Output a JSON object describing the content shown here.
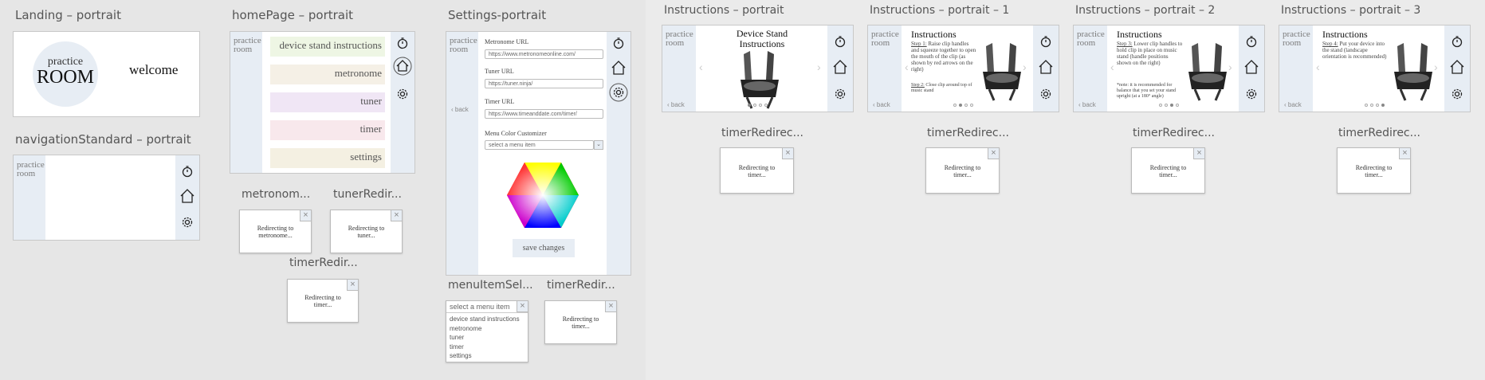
{
  "colors": {
    "nav_bg": "#e7edf4",
    "item_green": "#eef6e4",
    "item_beige": "#f5f0e6",
    "item_purple": "#f0e6f5",
    "item_pink": "#f8e8ec",
    "item_cream": "#f4f0e2",
    "save_bg": "#e7edf4"
  },
  "brand": {
    "practice": "practice",
    "room": "room"
  },
  "landing": {
    "label": "Landing – portrait",
    "logo_top": "practice",
    "logo_bottom": "ROOM",
    "welcome": "welcome"
  },
  "nav": {
    "label": "navigationStandard – portrait",
    "icons": [
      "stopwatch-icon",
      "home-icon",
      "gear-icon"
    ]
  },
  "home": {
    "label": "homePage – portrait",
    "items": [
      "device stand instructions",
      "metronome",
      "tuner",
      "timer",
      "settings"
    ]
  },
  "settings": {
    "label": "Settings-portrait",
    "back": "back",
    "metronome_label": "Metronome URL",
    "metronome_value": "https://www.metronomeonline.com/",
    "tuner_label": "Tuner URL",
    "tuner_value": "https://tuner.ninja/",
    "timer_label": "Timer URL",
    "timer_value": "https://www.timeanddate.com/timer/",
    "color_label": "Menu Color Customizer",
    "color_placeholder": "select a menu item",
    "save": "save changes"
  },
  "popups": {
    "metronome": {
      "label": "metronom...",
      "title_1": "Redirecting to",
      "title_2": "metronome..."
    },
    "tuner": {
      "label": "tunerRedir...",
      "title_1": "Redirecting to",
      "title_2": "tuner..."
    },
    "timer": {
      "label": "timerRedir...",
      "title_1": "Redirecting to",
      "title_2": "timer..."
    },
    "timer2": {
      "label": "timerRedir...",
      "title_1": "Redirecting to",
      "title_2": "timer..."
    },
    "timer_i0": {
      "label": "timerRedirec...",
      "title_1": "Redirecting to",
      "title_2": "timer..."
    },
    "timer_i1": {
      "label": "timerRedirec...",
      "title_1": "Redirecting to",
      "title_2": "timer..."
    },
    "timer_i2": {
      "label": "timerRedirec...",
      "title_1": "Redirecting to",
      "title_2": "timer..."
    },
    "timer_i3": {
      "label": "timerRedirec...",
      "title_1": "Redirecting to",
      "title_2": "timer..."
    }
  },
  "menu_select": {
    "label": "menuItemSel...",
    "placeholder": "select a menu item",
    "options": [
      "device stand instructions",
      "metronome",
      "tuner",
      "timer",
      "settings"
    ]
  },
  "instructions": [
    {
      "label": "Instructions – portrait",
      "title_1": "Device Stand",
      "title_2": "Instructions",
      "back": "back",
      "step_label": "",
      "text": "",
      "step2_label": "",
      "text2": "",
      "active_dot": 1
    },
    {
      "label": "Instructions – portrait – 1",
      "title_1": "Instructions",
      "title_2": "",
      "back": "back",
      "step_label": "Step 1:",
      "text": "Raise clip handles and squeeze together to open the mouth of the clip (as shown by red arrows on the right)",
      "step2_label": "Step 2:",
      "text2": "Close clip around top of music stand",
      "active_dot": 2
    },
    {
      "label": "Instructions – portrait – 2",
      "title_1": "Instructions",
      "title_2": "",
      "back": "back",
      "step_label": "Step 3:",
      "text": "Lower clip handles to hold clip in place on music stand (handle positions shown on the right)",
      "step2_label": "",
      "text2": "*note: it is recommended for balance that you set your stand upright (at a 180° angle)",
      "active_dot": 3
    },
    {
      "label": "Instructions – portrait – 3",
      "title_1": "Instructions",
      "title_2": "",
      "back": "back",
      "step_label": "Step 4:",
      "text": "Put your device into the stand (landscape orientation is recommended)",
      "step2_label": "",
      "text2": "",
      "active_dot": 4
    }
  ]
}
